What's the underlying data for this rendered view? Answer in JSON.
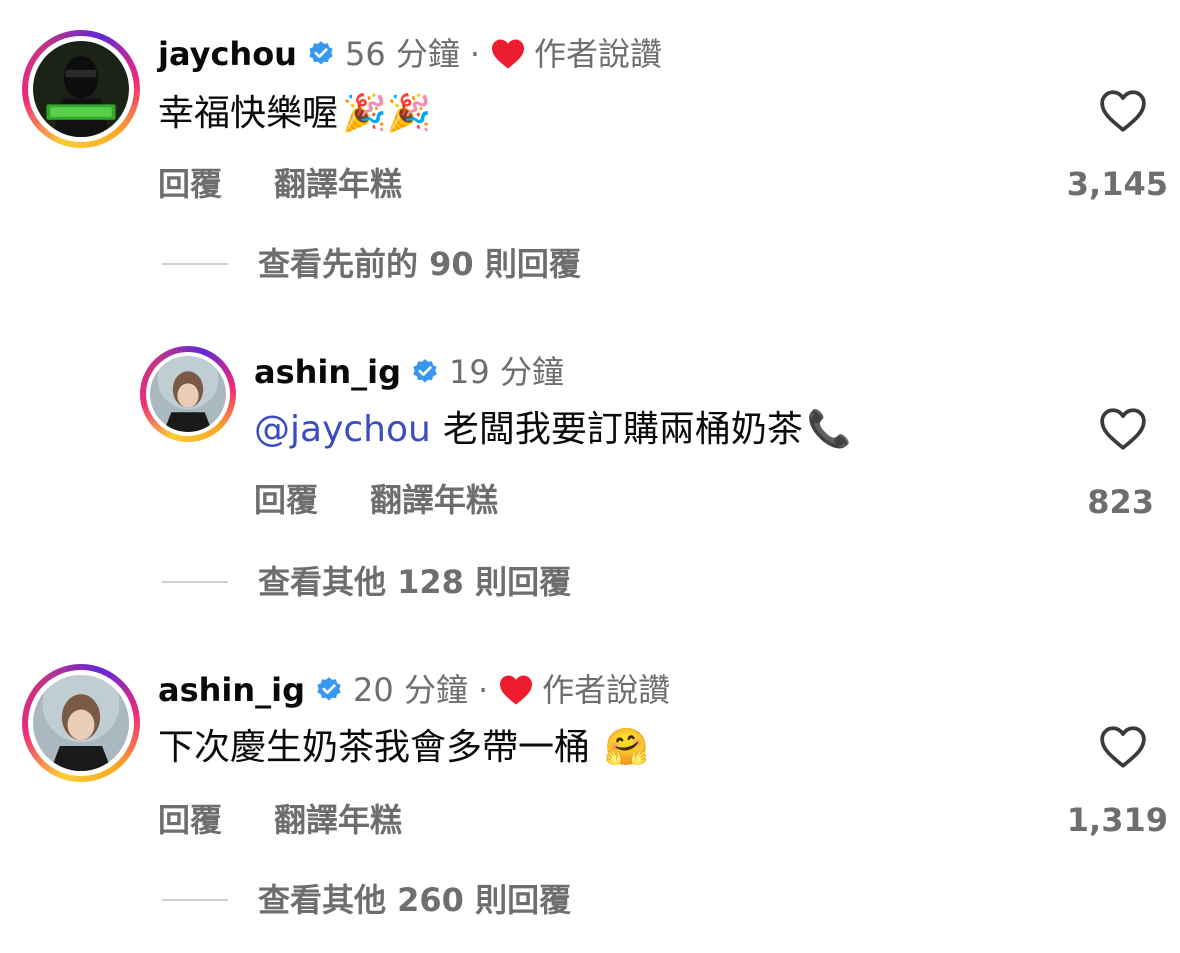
{
  "comments": [
    {
      "username": "jaychou",
      "time": "56 分鐘",
      "dot": "·",
      "author_liked": "作者說讚",
      "text": "幸福快樂喔",
      "emoji": "🎉🎉",
      "reply_label": "回覆",
      "translate_label": "翻譯年糕",
      "likes": "3,145",
      "view_replies": "查看先前的 90 則回覆"
    },
    {
      "username": "ashin_ig",
      "time": "19 分鐘",
      "mention": "@jaychou",
      "text": "老闆我要訂購兩桶奶茶",
      "emoji": "📞",
      "reply_label": "回覆",
      "translate_label": "翻譯年糕",
      "likes": "823",
      "view_replies": "查看其他 128 則回覆"
    },
    {
      "username": "ashin_ig",
      "time": "20 分鐘",
      "dot": "·",
      "author_liked": "作者說讚",
      "text": "下次慶生奶茶我會多帶一桶",
      "emoji": "🤗",
      "reply_label": "回覆",
      "translate_label": "翻譯年糕",
      "likes": "1,319",
      "view_replies": "查看其他 260 則回覆"
    }
  ],
  "colors": {
    "verified": "#3897f0",
    "liked_heart": "#ed1c2e",
    "mention": "#3b4cc0",
    "secondary_text": "#6e6e6e"
  },
  "icons": {
    "verified": "verified-badge-icon",
    "liked": "heart-filled-icon",
    "like": "heart-outline-icon"
  }
}
